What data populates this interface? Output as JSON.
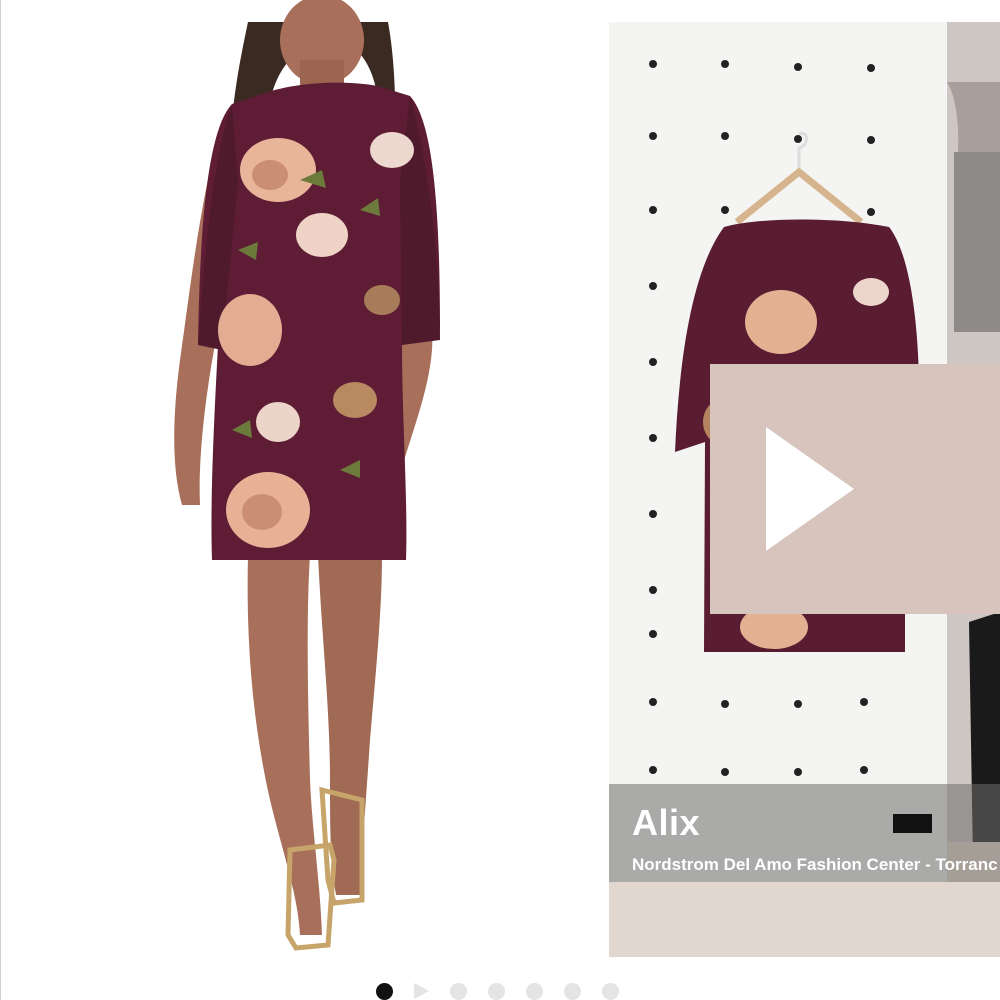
{
  "gallery": {
    "main_image": {
      "icon": "product-photo-floral-sequin-dress",
      "colors": {
        "dress": "#5e1d34",
        "skin": "#a8705a",
        "bloom": "#e8b49a"
      }
    },
    "video": {
      "icon": "play-icon",
      "caption": {
        "name": "Alix",
        "location": "Nordstrom Del Amo Fashion Center - Torranc"
      },
      "colors": {
        "overlay": "#d6c4bd",
        "play": "#ffffff"
      }
    },
    "pagination": {
      "total": 7,
      "active_index": 0,
      "video_index": 1
    }
  }
}
